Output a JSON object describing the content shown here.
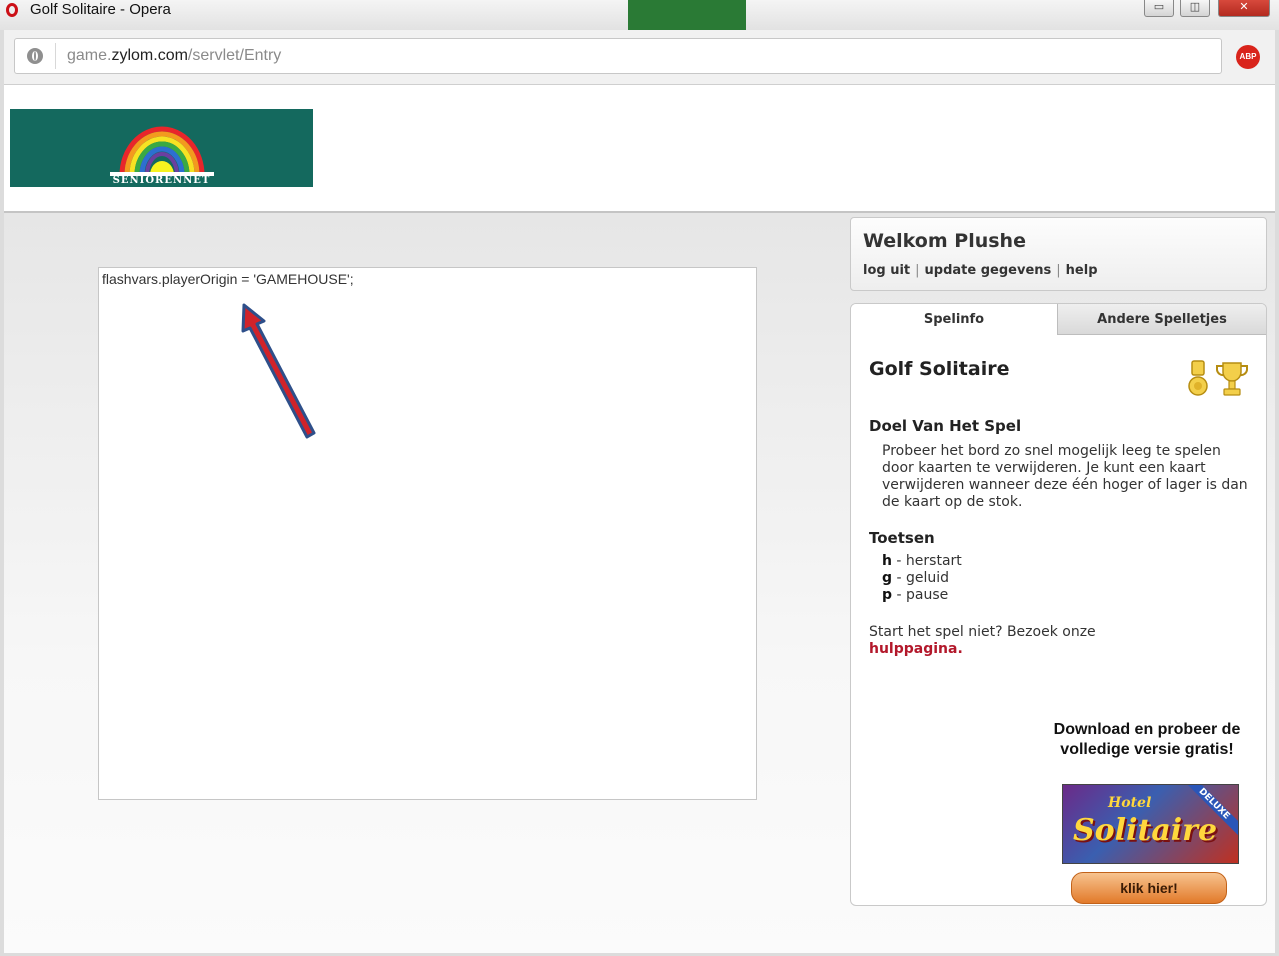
{
  "window": {
    "title": "Golf Solitaire - Opera",
    "min_label": "▭",
    "max_label": "◫",
    "close_label": "✕"
  },
  "addressbar": {
    "url_prefix": "game.",
    "url_host": "zylom.com",
    "url_path": "/servlet/Entry",
    "abp_label": "ABP"
  },
  "logo": {
    "text": "SENIORENNET"
  },
  "game_frame": {
    "code_text": "flashvars.playerOrigin = 'GAMEHOUSE';"
  },
  "welcome": {
    "title": "Welkom Plushe",
    "links": [
      "log uit",
      "update gegevens",
      "help"
    ],
    "separator": "|"
  },
  "tabs": [
    {
      "label": "Spelinfo",
      "active": true
    },
    {
      "label": "Andere Spelletjes",
      "active": false
    }
  ],
  "game_info": {
    "title": "Golf Solitaire",
    "goal_heading": "Doel Van Het Spel",
    "goal_text": "Probeer het bord zo snel mogelijk leeg te spelen door kaarten te verwijderen. Je kunt een kaart verwijderen wanneer deze één hoger of lager is dan de kaart op de stok.",
    "keys_heading": "Toetsen",
    "keys": [
      {
        "key": "h",
        "label": "- herstart"
      },
      {
        "key": "g",
        "label": "- geluid"
      },
      {
        "key": "p",
        "label": "- pause"
      }
    ],
    "help_text": "Start het spel niet? Bezoek onze",
    "help_link": "hulppagina."
  },
  "promo": {
    "heading": "Download en probeer de volledige versie gratis!",
    "image_hotel": "Hotel",
    "image_title": "Solitaire",
    "image_badge": "DELUXE",
    "button_label": "klik hier!"
  },
  "colors": {
    "logo_bg": "#14695e",
    "help_link": "#b3182b",
    "button_orange": "#e27a2a",
    "arrow_red": "#d0232a",
    "arrow_blue": "#2e4f8a"
  }
}
